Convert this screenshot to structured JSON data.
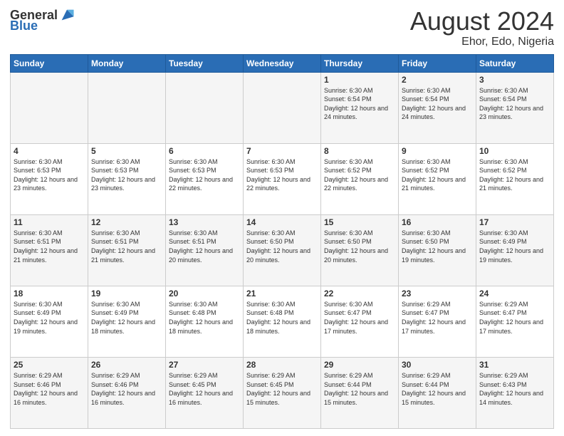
{
  "logo": {
    "text_general": "General",
    "text_blue": "Blue"
  },
  "title": "August 2024",
  "subtitle": "Ehor, Edo, Nigeria",
  "days_of_week": [
    "Sunday",
    "Monday",
    "Tuesday",
    "Wednesday",
    "Thursday",
    "Friday",
    "Saturday"
  ],
  "weeks": [
    [
      {
        "day": "",
        "sunrise": "",
        "sunset": "",
        "daylight": ""
      },
      {
        "day": "",
        "sunrise": "",
        "sunset": "",
        "daylight": ""
      },
      {
        "day": "",
        "sunrise": "",
        "sunset": "",
        "daylight": ""
      },
      {
        "day": "",
        "sunrise": "",
        "sunset": "",
        "daylight": ""
      },
      {
        "day": "1",
        "sunrise": "Sunrise: 6:30 AM",
        "sunset": "Sunset: 6:54 PM",
        "daylight": "Daylight: 12 hours and 24 minutes."
      },
      {
        "day": "2",
        "sunrise": "Sunrise: 6:30 AM",
        "sunset": "Sunset: 6:54 PM",
        "daylight": "Daylight: 12 hours and 24 minutes."
      },
      {
        "day": "3",
        "sunrise": "Sunrise: 6:30 AM",
        "sunset": "Sunset: 6:54 PM",
        "daylight": "Daylight: 12 hours and 23 minutes."
      }
    ],
    [
      {
        "day": "4",
        "sunrise": "Sunrise: 6:30 AM",
        "sunset": "Sunset: 6:53 PM",
        "daylight": "Daylight: 12 hours and 23 minutes."
      },
      {
        "day": "5",
        "sunrise": "Sunrise: 6:30 AM",
        "sunset": "Sunset: 6:53 PM",
        "daylight": "Daylight: 12 hours and 23 minutes."
      },
      {
        "day": "6",
        "sunrise": "Sunrise: 6:30 AM",
        "sunset": "Sunset: 6:53 PM",
        "daylight": "Daylight: 12 hours and 22 minutes."
      },
      {
        "day": "7",
        "sunrise": "Sunrise: 6:30 AM",
        "sunset": "Sunset: 6:53 PM",
        "daylight": "Daylight: 12 hours and 22 minutes."
      },
      {
        "day": "8",
        "sunrise": "Sunrise: 6:30 AM",
        "sunset": "Sunset: 6:52 PM",
        "daylight": "Daylight: 12 hours and 22 minutes."
      },
      {
        "day": "9",
        "sunrise": "Sunrise: 6:30 AM",
        "sunset": "Sunset: 6:52 PM",
        "daylight": "Daylight: 12 hours and 21 minutes."
      },
      {
        "day": "10",
        "sunrise": "Sunrise: 6:30 AM",
        "sunset": "Sunset: 6:52 PM",
        "daylight": "Daylight: 12 hours and 21 minutes."
      }
    ],
    [
      {
        "day": "11",
        "sunrise": "Sunrise: 6:30 AM",
        "sunset": "Sunset: 6:51 PM",
        "daylight": "Daylight: 12 hours and 21 minutes."
      },
      {
        "day": "12",
        "sunrise": "Sunrise: 6:30 AM",
        "sunset": "Sunset: 6:51 PM",
        "daylight": "Daylight: 12 hours and 21 minutes."
      },
      {
        "day": "13",
        "sunrise": "Sunrise: 6:30 AM",
        "sunset": "Sunset: 6:51 PM",
        "daylight": "Daylight: 12 hours and 20 minutes."
      },
      {
        "day": "14",
        "sunrise": "Sunrise: 6:30 AM",
        "sunset": "Sunset: 6:50 PM",
        "daylight": "Daylight: 12 hours and 20 minutes."
      },
      {
        "day": "15",
        "sunrise": "Sunrise: 6:30 AM",
        "sunset": "Sunset: 6:50 PM",
        "daylight": "Daylight: 12 hours and 20 minutes."
      },
      {
        "day": "16",
        "sunrise": "Sunrise: 6:30 AM",
        "sunset": "Sunset: 6:50 PM",
        "daylight": "Daylight: 12 hours and 19 minutes."
      },
      {
        "day": "17",
        "sunrise": "Sunrise: 6:30 AM",
        "sunset": "Sunset: 6:49 PM",
        "daylight": "Daylight: 12 hours and 19 minutes."
      }
    ],
    [
      {
        "day": "18",
        "sunrise": "Sunrise: 6:30 AM",
        "sunset": "Sunset: 6:49 PM",
        "daylight": "Daylight: 12 hours and 19 minutes."
      },
      {
        "day": "19",
        "sunrise": "Sunrise: 6:30 AM",
        "sunset": "Sunset: 6:49 PM",
        "daylight": "Daylight: 12 hours and 18 minutes."
      },
      {
        "day": "20",
        "sunrise": "Sunrise: 6:30 AM",
        "sunset": "Sunset: 6:48 PM",
        "daylight": "Daylight: 12 hours and 18 minutes."
      },
      {
        "day": "21",
        "sunrise": "Sunrise: 6:30 AM",
        "sunset": "Sunset: 6:48 PM",
        "daylight": "Daylight: 12 hours and 18 minutes."
      },
      {
        "day": "22",
        "sunrise": "Sunrise: 6:30 AM",
        "sunset": "Sunset: 6:47 PM",
        "daylight": "Daylight: 12 hours and 17 minutes."
      },
      {
        "day": "23",
        "sunrise": "Sunrise: 6:29 AM",
        "sunset": "Sunset: 6:47 PM",
        "daylight": "Daylight: 12 hours and 17 minutes."
      },
      {
        "day": "24",
        "sunrise": "Sunrise: 6:29 AM",
        "sunset": "Sunset: 6:47 PM",
        "daylight": "Daylight: 12 hours and 17 minutes."
      }
    ],
    [
      {
        "day": "25",
        "sunrise": "Sunrise: 6:29 AM",
        "sunset": "Sunset: 6:46 PM",
        "daylight": "Daylight: 12 hours and 16 minutes."
      },
      {
        "day": "26",
        "sunrise": "Sunrise: 6:29 AM",
        "sunset": "Sunset: 6:46 PM",
        "daylight": "Daylight: 12 hours and 16 minutes."
      },
      {
        "day": "27",
        "sunrise": "Sunrise: 6:29 AM",
        "sunset": "Sunset: 6:45 PM",
        "daylight": "Daylight: 12 hours and 16 minutes."
      },
      {
        "day": "28",
        "sunrise": "Sunrise: 6:29 AM",
        "sunset": "Sunset: 6:45 PM",
        "daylight": "Daylight: 12 hours and 15 minutes."
      },
      {
        "day": "29",
        "sunrise": "Sunrise: 6:29 AM",
        "sunset": "Sunset: 6:44 PM",
        "daylight": "Daylight: 12 hours and 15 minutes."
      },
      {
        "day": "30",
        "sunrise": "Sunrise: 6:29 AM",
        "sunset": "Sunset: 6:44 PM",
        "daylight": "Daylight: 12 hours and 15 minutes."
      },
      {
        "day": "31",
        "sunrise": "Sunrise: 6:29 AM",
        "sunset": "Sunset: 6:43 PM",
        "daylight": "Daylight: 12 hours and 14 minutes."
      }
    ]
  ]
}
